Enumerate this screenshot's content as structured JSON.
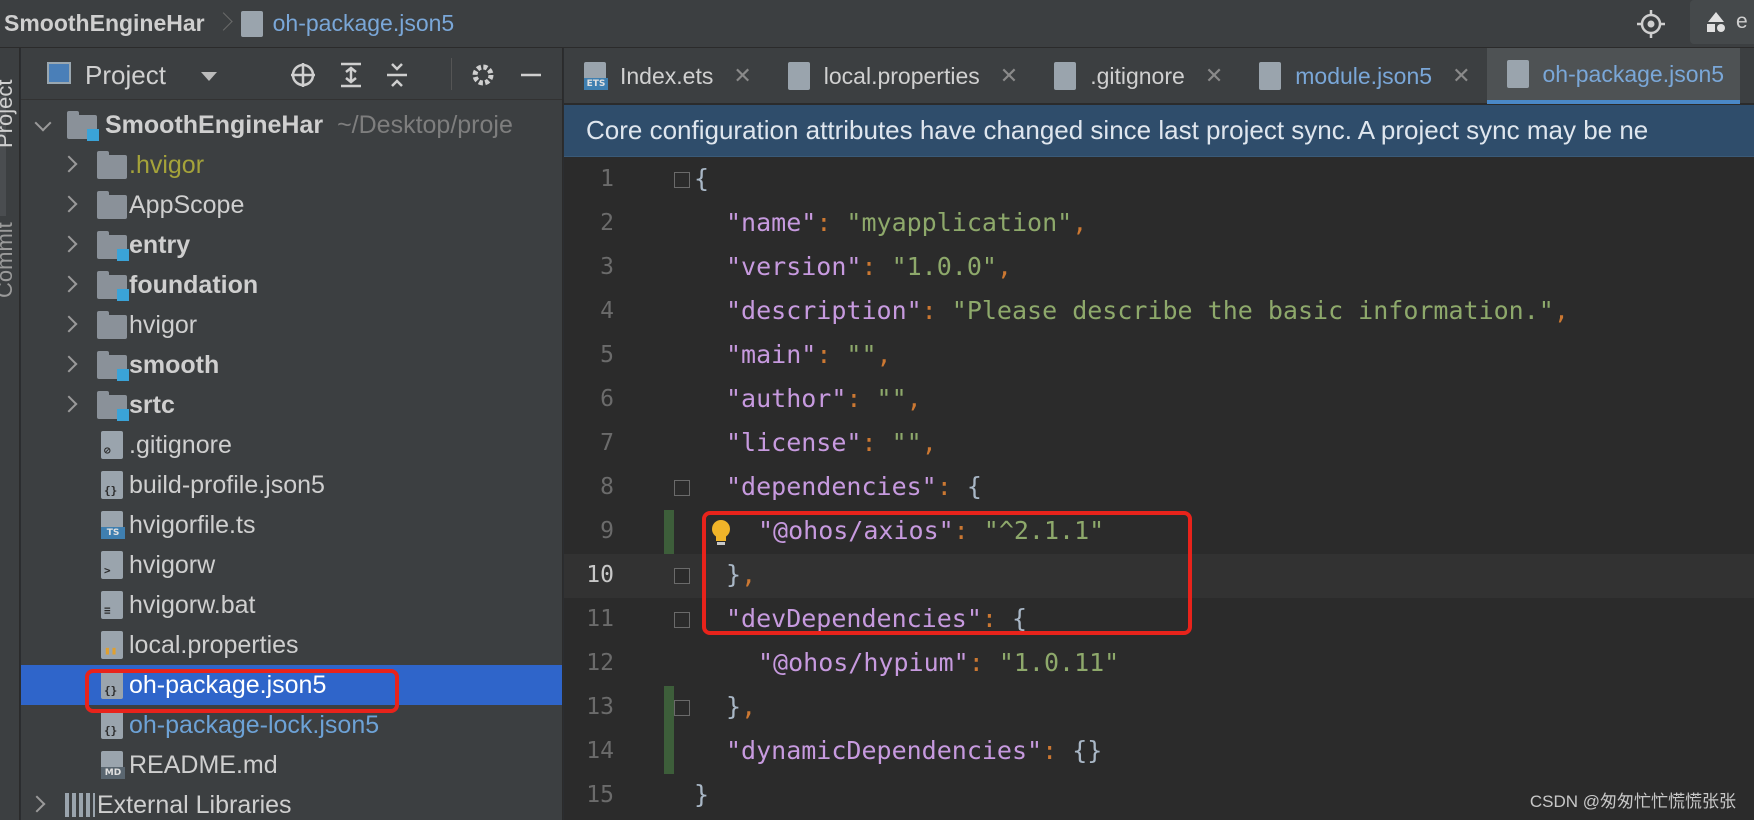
{
  "breadcrumb": {
    "project": "SmoothEngineHar",
    "file": "oh-package.json5",
    "run_label": "e"
  },
  "tool_strip": {
    "project_label": "Project",
    "commit_label": "Commit"
  },
  "project_panel": {
    "title": "Project",
    "root": {
      "name": "SmoothEngineHar",
      "path": "~/Desktop/proje"
    },
    "items": [
      {
        "label": ".hvigor",
        "kind": "folder",
        "style": "olive"
      },
      {
        "label": "AppScope",
        "kind": "folder",
        "style": "normal"
      },
      {
        "label": "entry",
        "kind": "module",
        "style": "bold"
      },
      {
        "label": "foundation",
        "kind": "module",
        "style": "bold"
      },
      {
        "label": "hvigor",
        "kind": "folder",
        "style": "normal"
      },
      {
        "label": "smooth",
        "kind": "module",
        "style": "bold"
      },
      {
        "label": "srtc",
        "kind": "module",
        "style": "bold"
      },
      {
        "label": ".gitignore",
        "kind": "file",
        "style": "normal"
      },
      {
        "label": "build-profile.json5",
        "kind": "json",
        "style": "normal"
      },
      {
        "label": "hvigorfile.ts",
        "kind": "ts",
        "style": "normal"
      },
      {
        "label": "hvigorw",
        "kind": "exec",
        "style": "normal"
      },
      {
        "label": "hvigorw.bat",
        "kind": "file",
        "style": "normal"
      },
      {
        "label": "local.properties",
        "kind": "props",
        "style": "normal"
      },
      {
        "label": "oh-package.json5",
        "kind": "json",
        "style": "selected"
      },
      {
        "label": "oh-package-lock.json5",
        "kind": "json",
        "style": "blue"
      },
      {
        "label": "README.md",
        "kind": "md",
        "style": "normal"
      }
    ],
    "external": "External Libraries"
  },
  "tabs": [
    {
      "label": "Index.ets",
      "active": false
    },
    {
      "label": "local.properties",
      "active": false
    },
    {
      "label": ".gitignore",
      "active": false
    },
    {
      "label": "module.json5",
      "active": false
    },
    {
      "label": "oh-package.json5",
      "active": true
    }
  ],
  "banner": "Core configuration attributes have changed since last project sync. A project sync may be ne",
  "code_lines": [
    {
      "n": "1"
    },
    {
      "n": "2"
    },
    {
      "n": "3"
    },
    {
      "n": "4"
    },
    {
      "n": "5"
    },
    {
      "n": "6"
    },
    {
      "n": "7"
    },
    {
      "n": "8"
    },
    {
      "n": "9"
    },
    {
      "n": "10"
    },
    {
      "n": "11"
    },
    {
      "n": "12"
    },
    {
      "n": "13"
    },
    {
      "n": "14"
    },
    {
      "n": "15"
    }
  ],
  "code": {
    "l2k": "\"name\"",
    "l2v": "\"myapplication\"",
    "l3k": "\"version\"",
    "l3v": "\"1.0.0\"",
    "l4k": "\"description\"",
    "l4v": "\"Please describe the basic information.\"",
    "l5k": "\"main\"",
    "l5v": "\"\"",
    "l6k": "\"author\"",
    "l6v": "\"\"",
    "l7k": "\"license\"",
    "l7v": "\"\"",
    "l8k": "\"dependencies\"",
    "l9k": "\"@ohos/axios\"",
    "l9v": "\"^2.1.1\"",
    "l11k": "\"devDependencies\"",
    "l12k": "\"@ohos/hypium\"",
    "l12v": "\"1.0.11\"",
    "l14k": "\"dynamicDependencies\""
  },
  "watermark": "CSDN @匆匆忙忙慌慌张张",
  "colors": {
    "selection": "#2f65ca",
    "highlight_box": "#e8231b",
    "banner": "#2f4d6b",
    "string": "#8ea96b",
    "key": "#c79adf"
  }
}
